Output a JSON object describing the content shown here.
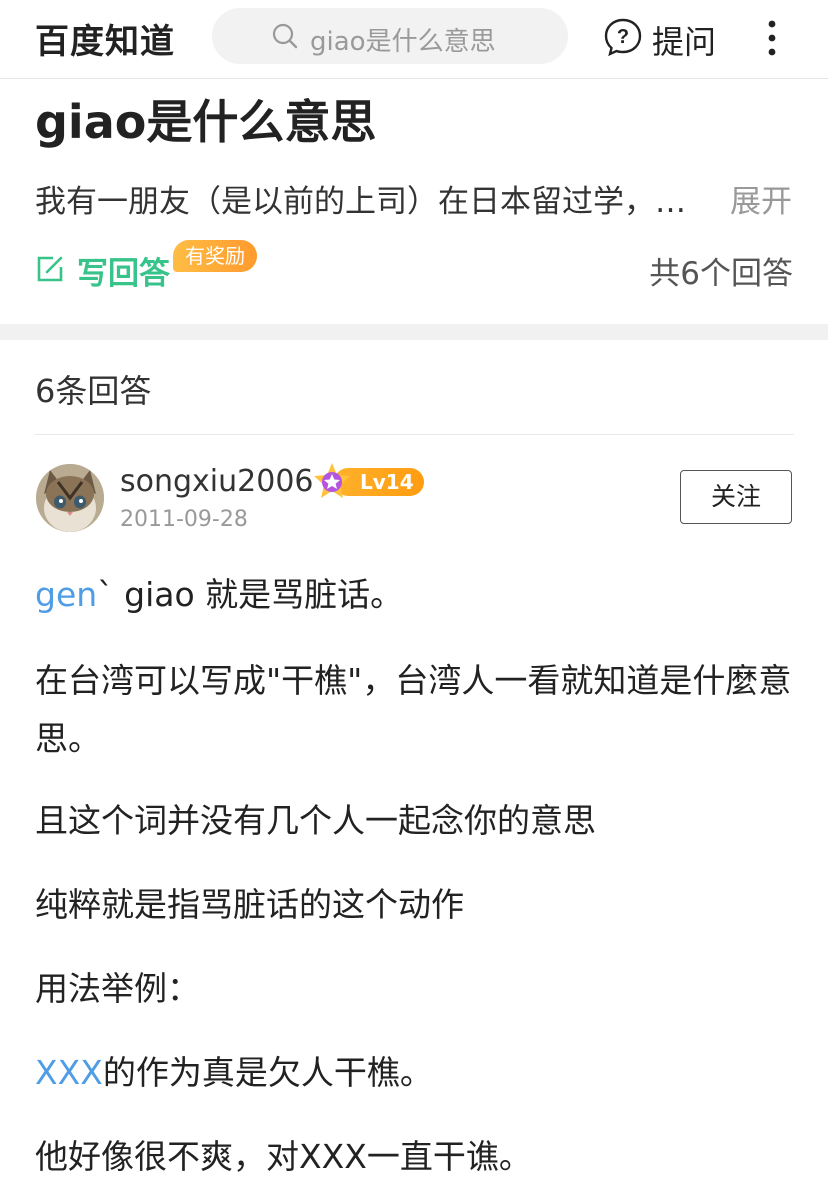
{
  "header": {
    "logo": "百度知道",
    "search_placeholder": "giao是什么意思",
    "ask_label": "提问"
  },
  "question": {
    "title": "giao是什么意思",
    "description": "我有一朋友（是以前的上司）在日本留过学，…",
    "expand_label": "展开",
    "write_answer_label": "写回答",
    "reward_badge": "有奖励",
    "answer_count": "共6个回答"
  },
  "answers_section": {
    "heading": "6条回答"
  },
  "answer": {
    "username": "songxiu2006",
    "level": "Lv14",
    "date": "2011-09-28",
    "follow_label": "关注",
    "paragraphs": {
      "p1_link": "gen",
      "p1_text": "` giao 就是骂脏话。",
      "p2": "在台湾可以写成\"干樵\"，台湾人一看就知道是什麼意思。",
      "p3": "且这个词并没有几个人一起念你的意思",
      "p4": "纯粹就是指骂脏话的这个动作",
      "p5": "用法举例：",
      "p6_link": "XXX",
      "p6_text": "的作为真是欠人干樵。",
      "p7": "他好像很不爽，对XXX一直干谯。"
    }
  },
  "colors": {
    "accent_green": "#38c38b",
    "link_blue": "#4e9de6",
    "badge_orange": "#ffa528"
  },
  "icons": [
    "search-icon",
    "question-bubble-icon",
    "more-vertical-icon",
    "edit-icon",
    "level-star-icon"
  ]
}
